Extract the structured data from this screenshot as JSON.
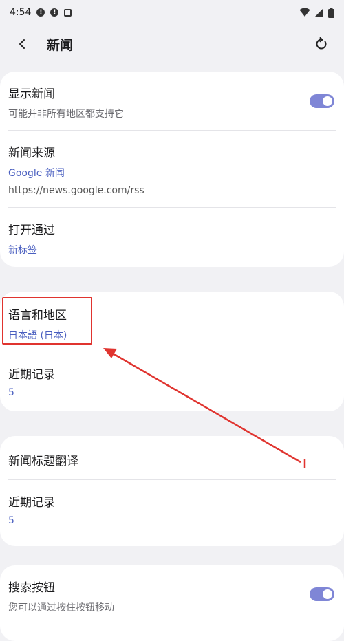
{
  "status_bar": {
    "time": "4:54",
    "icons": [
      "alert-circle-icon",
      "alert-circle-icon",
      "screenshot-icon",
      "wifi-icon",
      "signal-icon",
      "battery-icon"
    ]
  },
  "header": {
    "title": "新闻",
    "back_icon": "chevron-left-icon",
    "refresh_icon": "refresh-icon"
  },
  "sections": [
    {
      "rows": [
        {
          "title": "显示新闻",
          "subtitle": "可能并非所有地区都支持它",
          "toggle": true
        },
        {
          "title": "新闻来源",
          "link": "Google 新闻",
          "url": "https://news.google.com/rss"
        },
        {
          "title": "打开通过",
          "link": "新标签"
        }
      ]
    },
    {
      "rows": [
        {
          "title": "语言和地区",
          "link": "日本語 (日本)"
        },
        {
          "title": "近期记录",
          "link": "5"
        }
      ]
    },
    {
      "rows": [
        {
          "title": "新闻标题翻译"
        },
        {
          "title": "近期记录",
          "link": "5"
        }
      ]
    },
    {
      "rows": [
        {
          "title": "搜索按钮",
          "subtitle": "您可以通过按住按钮移动",
          "toggle": true
        }
      ]
    }
  ],
  "colors": {
    "accent": "#4a5fc0",
    "toggle_on": "#7f86d6",
    "annotation_red": "#e0342f",
    "background": "#f1f1f4"
  }
}
